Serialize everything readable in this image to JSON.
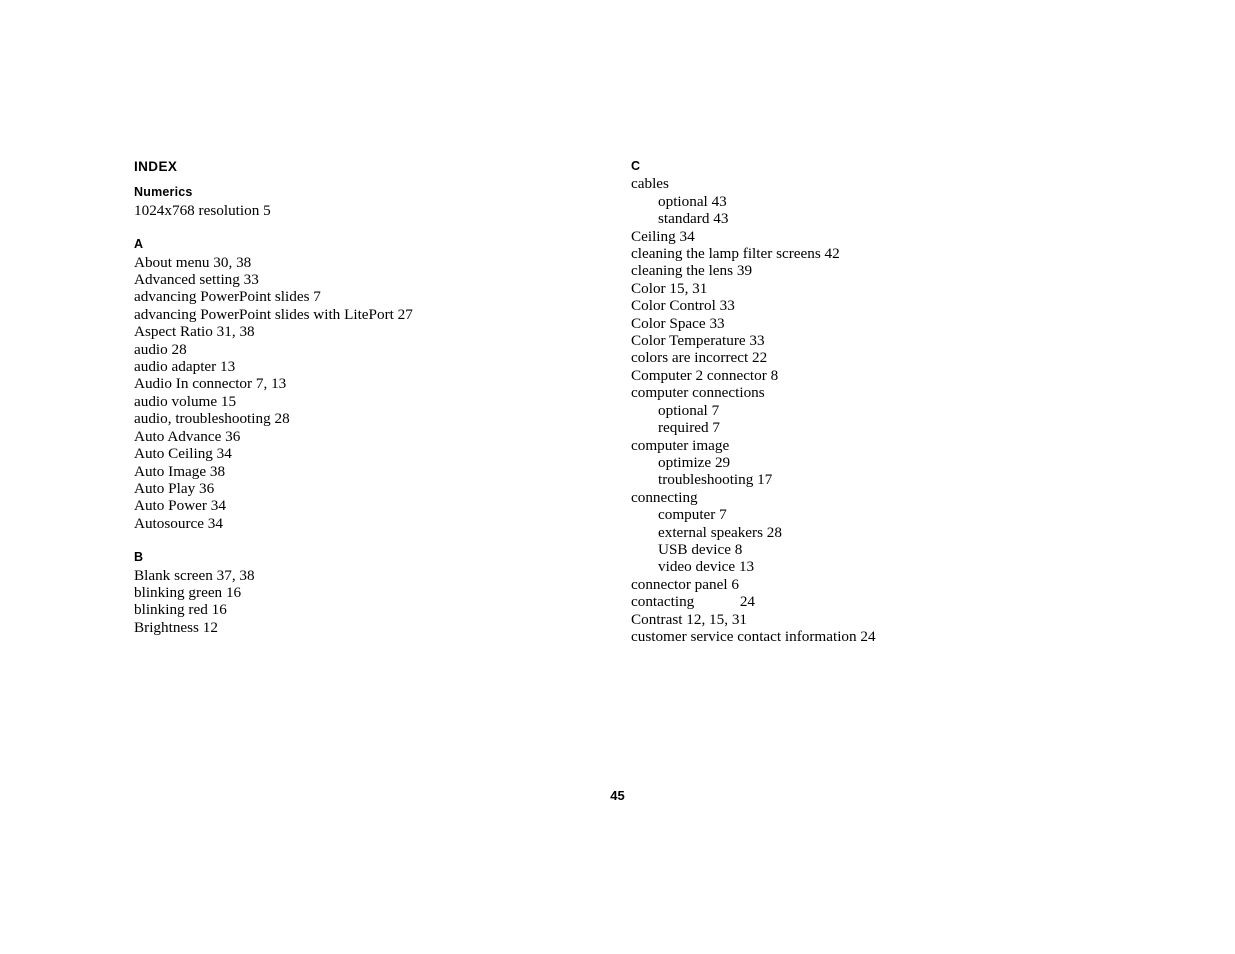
{
  "document": {
    "title": "INDEX",
    "page_number": "45"
  },
  "columns": [
    {
      "name": "left-column",
      "sections": [
        {
          "heading": "Numerics",
          "entries": [
            {
              "text": "1024x768 resolution 5",
              "level": 0
            }
          ]
        },
        {
          "heading": "A",
          "entries": [
            {
              "text": "About menu 30, 38",
              "level": 0
            },
            {
              "text": "Advanced setting 33",
              "level": 0
            },
            {
              "text": "advancing PowerPoint slides 7",
              "level": 0
            },
            {
              "text": "advancing PowerPoint slides with LitePort 27",
              "level": 0
            },
            {
              "text": "Aspect Ratio 31, 38",
              "level": 0
            },
            {
              "text": "audio 28",
              "level": 0
            },
            {
              "text": "audio adapter 13",
              "level": 0
            },
            {
              "text": "Audio In connector 7, 13",
              "level": 0
            },
            {
              "text": "audio volume 15",
              "level": 0
            },
            {
              "text": "audio, troubleshooting 28",
              "level": 0
            },
            {
              "text": "Auto Advance 36",
              "level": 0
            },
            {
              "text": "Auto Ceiling 34",
              "level": 0
            },
            {
              "text": "Auto Image 38",
              "level": 0
            },
            {
              "text": "Auto Play 36",
              "level": 0
            },
            {
              "text": "Auto Power 34",
              "level": 0
            },
            {
              "text": "Autosource 34",
              "level": 0
            }
          ]
        },
        {
          "heading": "B",
          "entries": [
            {
              "text": "Blank screen 37, 38",
              "level": 0
            },
            {
              "text": "blinking green 16",
              "level": 0
            },
            {
              "text": "blinking red 16",
              "level": 0
            },
            {
              "text": "Brightness 12",
              "level": 0
            }
          ]
        }
      ]
    },
    {
      "name": "right-column",
      "sections": [
        {
          "heading": "C",
          "entries": [
            {
              "text": "cables",
              "level": 0
            },
            {
              "text": "optional 43",
              "level": 1
            },
            {
              "text": "standard 43",
              "level": 1
            },
            {
              "text": "Ceiling 34",
              "level": 0
            },
            {
              "text": "cleaning the lamp filter screens 42",
              "level": 0
            },
            {
              "text": "cleaning the lens 39",
              "level": 0
            },
            {
              "text": "Color 15, 31",
              "level": 0
            },
            {
              "text": "Color Control 33",
              "level": 0
            },
            {
              "text": "Color Space 33",
              "level": 0
            },
            {
              "text": "Color Temperature 33",
              "level": 0
            },
            {
              "text": "colors are incorrect 22",
              "level": 0
            },
            {
              "text": "Computer 2 connector 8",
              "level": 0
            },
            {
              "text": "computer connections",
              "level": 0
            },
            {
              "text": "optional 7",
              "level": 1
            },
            {
              "text": "required 7",
              "level": 1
            },
            {
              "text": "computer image",
              "level": 0
            },
            {
              "text": "optimize 29",
              "level": 1
            },
            {
              "text": "troubleshooting 17",
              "level": 1
            },
            {
              "text": "connecting",
              "level": 0
            },
            {
              "text": "computer 7",
              "level": 1
            },
            {
              "text": "external speakers 28",
              "level": 1
            },
            {
              "text": "USB device 8",
              "level": 1
            },
            {
              "text": "video device 13",
              "level": 1
            },
            {
              "text": "connector panel 6",
              "level": 0
            },
            {
              "text": "contacting            24",
              "level": 0
            },
            {
              "text": "Contrast 12, 15, 31",
              "level": 0
            },
            {
              "text": "customer service contact information 24",
              "level": 0
            }
          ]
        }
      ]
    }
  ]
}
